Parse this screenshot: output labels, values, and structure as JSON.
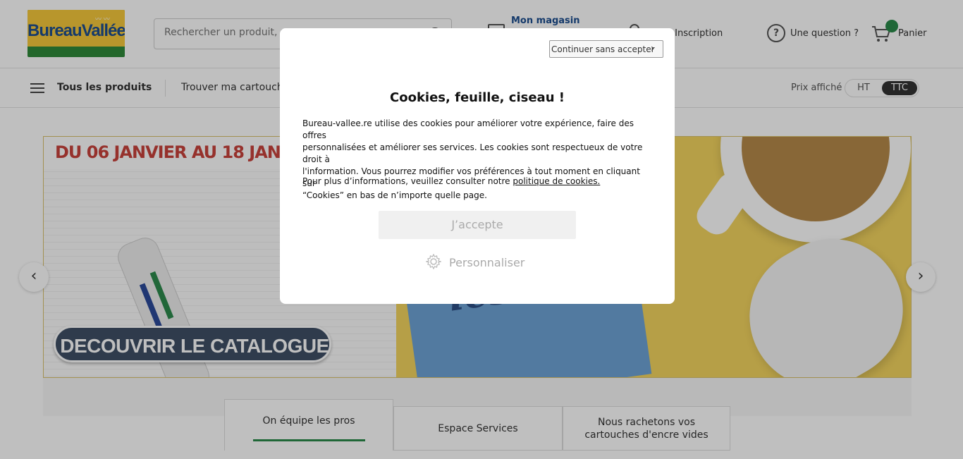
{
  "header": {
    "logo_text": "BureauVallée",
    "search_placeholder": "Rechercher un produit, u",
    "store_label": "Mon magasin",
    "account_label": "xion / Inscription",
    "question_label": "Une question ?",
    "cart_label": "Panier"
  },
  "navbar": {
    "all_products": "Tous les produits",
    "find_cartridge": "Trouver ma cartouche",
    "price_label": "Prix affiché",
    "price_ht": "HT",
    "price_ttc": "TTC",
    "selected_price_mode": "TTC"
  },
  "banner": {
    "date_text": "DU 06 JANVIER AU 18 JANV",
    "postit_text": "les PROS !",
    "cta_label": "DECOUVRIR LE CATALOGUE",
    "prev_arrow": "‹",
    "next_arrow": "›"
  },
  "tabs": [
    {
      "label": "On équipe les pros",
      "active": true
    },
    {
      "label": "Espace Services",
      "active": false
    },
    {
      "label_line1": "Nous rachetons vos",
      "label_line2": "cartouches d'encre vides",
      "active": false
    }
  ],
  "modal": {
    "skip_label": "Continuer sans accepter",
    "title": "Cookies, feuille, ciseau !",
    "body_line1": "Bureau-vallee.re utilise des cookies pour améliorer votre expérience, faire des offres",
    "body_line2": "personnalisées et améliorer ses services. Les cookies sont respectueux de votre droit à",
    "body_line3": "l'information. Vous pourrez modifier vos préférences à tout moment en cliquant sur",
    "body_line4": "“Cookies” en bas de n’importe quelle page.",
    "more_prefix": "Pour plus d’informations, veuillez consulter notre ",
    "more_link": "politique de cookies.",
    "accept_label": "J’accepte",
    "customize_label": "Personnaliser"
  },
  "colors": {
    "accent_green": "#2a8a4a",
    "brand_blue": "#1c4e8f",
    "brand_yellow": "#f6c93b"
  }
}
